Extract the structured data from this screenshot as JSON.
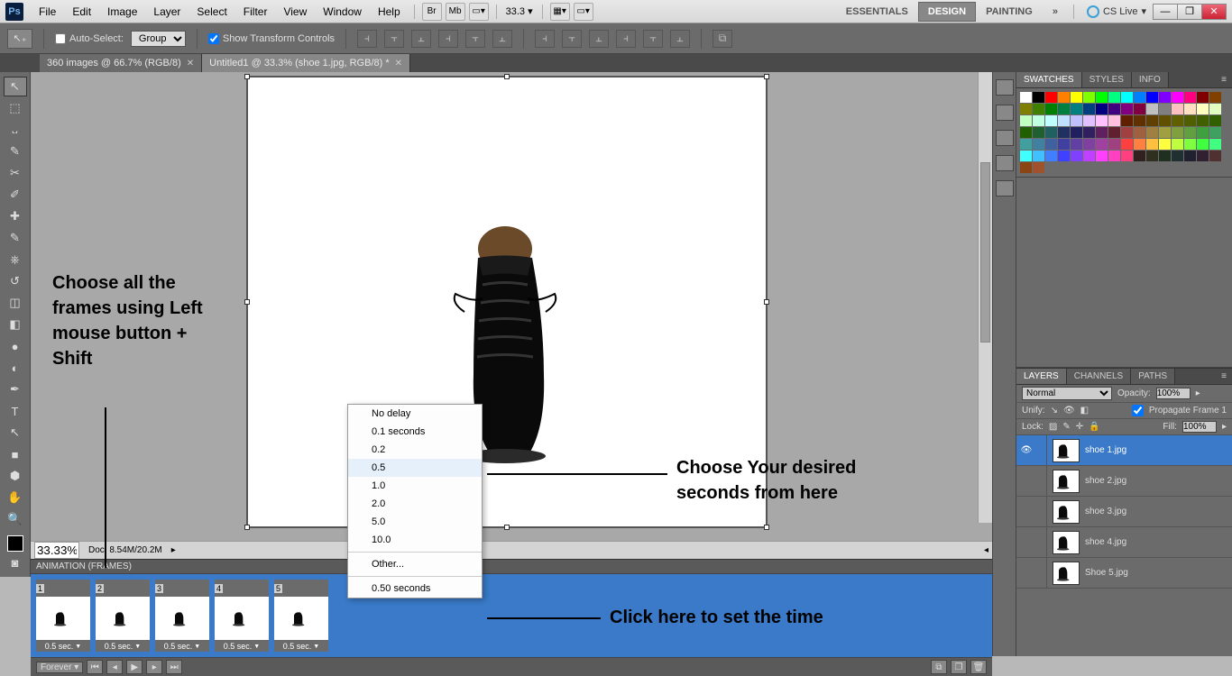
{
  "menubar": {
    "items": [
      "File",
      "Edit",
      "Image",
      "Layer",
      "Select",
      "Filter",
      "View",
      "Window",
      "Help"
    ],
    "zoom": "33.3",
    "workspaces": [
      "ESSENTIALS",
      "DESIGN",
      "PAINTING"
    ],
    "active_workspace": 1,
    "cslive": "CS Live"
  },
  "optbar": {
    "auto_select": "Auto-Select:",
    "auto_select_mode": "Group",
    "show_transform": "Show Transform Controls"
  },
  "doctabs": [
    {
      "label": "360 images @ 66.7% (RGB/8)",
      "active": false
    },
    {
      "label": "Untitled1 @ 33.3% (shoe 1.jpg, RGB/8) *",
      "active": true
    }
  ],
  "status": {
    "zoom": "33.33%",
    "doc": "Doc: 8.54M/20.2M"
  },
  "animation": {
    "title": "ANIMATION (FRAMES)",
    "frames": [
      {
        "n": "1",
        "t": "0.5 sec."
      },
      {
        "n": "2",
        "t": "0.5 sec."
      },
      {
        "n": "3",
        "t": "0.5 sec."
      },
      {
        "n": "4",
        "t": "0.5 sec."
      },
      {
        "n": "5",
        "t": "0.5 sec."
      }
    ],
    "loop": "Forever"
  },
  "delay_menu": {
    "items": [
      "No delay",
      "0.1 seconds",
      "0.2",
      "0.5",
      "1.0",
      "2.0",
      "5.0",
      "10.0"
    ],
    "other": "Other...",
    "current": "0.50 seconds",
    "hover_index": 3
  },
  "right": {
    "swatches_tabs": [
      "SWATCHES",
      "STYLES",
      "INFO"
    ],
    "layers_tabs": [
      "LAYERS",
      "CHANNELS",
      "PATHS"
    ],
    "blend": "Normal",
    "opacity_label": "Opacity:",
    "opacity": "100%",
    "unify": "Unify:",
    "propagate": "Propagate Frame 1",
    "lock": "Lock:",
    "fill_label": "Fill:",
    "fill": "100%",
    "layers": [
      {
        "name": "shoe 1.jpg",
        "sel": true,
        "visible": true
      },
      {
        "name": "shoe 2.jpg",
        "sel": false,
        "visible": false
      },
      {
        "name": "shoe 3.jpg",
        "sel": false,
        "visible": false
      },
      {
        "name": "shoe 4.jpg",
        "sel": false,
        "visible": false
      },
      {
        "name": "Shoe 5.jpg",
        "sel": false,
        "visible": false
      }
    ]
  },
  "annotations": {
    "a1": "Choose all the frames using Left mouse button + Shift",
    "a2": "Choose Your desired seconds from here",
    "a3": "Click here to set the time"
  },
  "swatch_colors": [
    "#ffffff",
    "#000000",
    "#ff0000",
    "#ff8000",
    "#ffff00",
    "#80ff00",
    "#00ff00",
    "#00ff80",
    "#00ffff",
    "#0080ff",
    "#0000ff",
    "#8000ff",
    "#ff00ff",
    "#ff0080",
    "#800000",
    "#804000",
    "#808000",
    "#408000",
    "#008000",
    "#008040",
    "#008080",
    "#004080",
    "#000080",
    "#400080",
    "#800080",
    "#800040",
    "#c0c0c0",
    "#808080",
    "#ffc0c0",
    "#ffe0c0",
    "#ffffc0",
    "#e0ffc0",
    "#c0ffc0",
    "#c0ffe0",
    "#c0ffff",
    "#c0e0ff",
    "#c0c0ff",
    "#e0c0ff",
    "#ffc0ff",
    "#ffc0e0",
    "#602000",
    "#603000",
    "#604000",
    "#605000",
    "#606000",
    "#506000",
    "#406000",
    "#306000",
    "#206000",
    "#206030",
    "#206060",
    "#203060",
    "#202060",
    "#302060",
    "#602060",
    "#602030",
    "#a04040",
    "#a06040",
    "#a08040",
    "#a0a040",
    "#80a040",
    "#60a040",
    "#40a040",
    "#40a060",
    "#40a0a0",
    "#4080a0",
    "#4060a0",
    "#4040a0",
    "#6040a0",
    "#8040a0",
    "#a040a0",
    "#a04080",
    "#ff4040",
    "#ff8040",
    "#ffc040",
    "#ffff40",
    "#c0ff40",
    "#80ff40",
    "#40ff40",
    "#40ff80",
    "#40ffff",
    "#40c0ff",
    "#4080ff",
    "#4040ff",
    "#8040ff",
    "#c040ff",
    "#ff40ff",
    "#ff40c0",
    "#ff4080",
    "#302020",
    "#303020",
    "#203020",
    "#203030",
    "#202030",
    "#302030",
    "#503030",
    "#8b4513",
    "#a0522d"
  ]
}
